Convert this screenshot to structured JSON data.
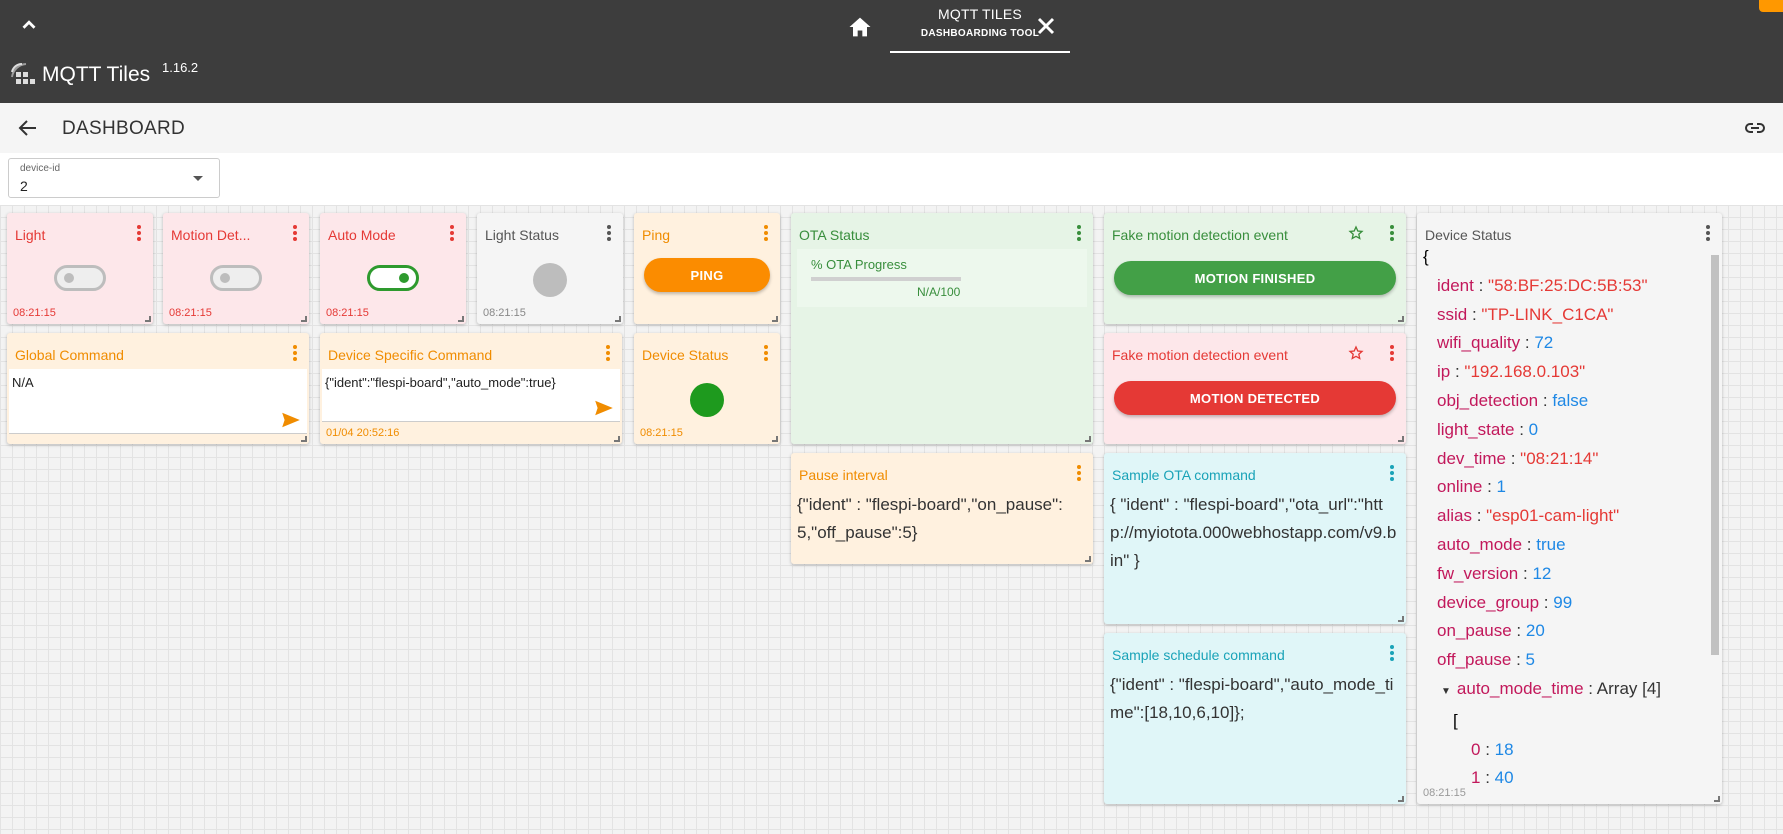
{
  "header": {
    "tab_title": "MQTT TILES",
    "tab_subtitle": "DASHBOARDING TOOL",
    "brand_name": "MQTT Tiles",
    "version": "1.16.2"
  },
  "toolbar": {
    "title": "DASHBOARD"
  },
  "selector": {
    "label": "device-id",
    "value": "2"
  },
  "tiles": {
    "light": {
      "title": "Light",
      "time": "08:21:15"
    },
    "motion": {
      "title": "Motion Det...",
      "time": "08:21:15"
    },
    "auto_mode": {
      "title": "Auto Mode",
      "time": "08:21:15"
    },
    "light_status": {
      "title": "Light Status",
      "time": "08:21:15"
    },
    "ping": {
      "title": "Ping",
      "button": "PING"
    },
    "ota_status": {
      "title": "OTA Status",
      "progress_label": "% OTA Progress",
      "progress_value": "N/A/100"
    },
    "motion_finished": {
      "title": "Fake motion detection event",
      "button": "MOTION FINISHED"
    },
    "motion_detected": {
      "title": "Fake motion detection event",
      "button": "MOTION DETECTED"
    },
    "global_cmd": {
      "title": "Global Command",
      "value": "N/A"
    },
    "device_cmd": {
      "title": "Device Specific Command",
      "value": "{\"ident\":\"flespi-board\",\"auto_mode\":true}",
      "time": "01/04 20:52:16"
    },
    "device_status_small": {
      "title": "Device Status",
      "time": "08:21:15"
    },
    "pause_interval": {
      "title": "Pause interval",
      "text": "{\"ident\" : \"flespi-board\",\"on_pause\": 5,\"off_pause\":5}"
    },
    "sample_ota": {
      "title": "Sample OTA command",
      "text": "{ \"ident\" : \"flespi-board\",\"ota_url\":\"http://myiotota.000webhostapp.com/v9.bin\" }"
    },
    "sample_schedule": {
      "title": "Sample schedule command",
      "text": "{\"ident\" : \"flespi-board\",\"auto_mode_time\":[18,10,6,10]};"
    },
    "device_status_json": {
      "title": "Device Status",
      "time": "08:21:15",
      "open_brace": "{",
      "open_bracket": "[",
      "rows": [
        {
          "key": "ident",
          "value": "\"58:BF:25:DC:5B:53\""
        },
        {
          "key": "ssid",
          "value": "\"TP-LINK_C1CA\""
        },
        {
          "key": "wifi_quality",
          "value": "72"
        },
        {
          "key": "ip",
          "value": "\"192.168.0.103\""
        },
        {
          "key": "obj_detection",
          "value": "false"
        },
        {
          "key": "light_state",
          "value": "0"
        },
        {
          "key": "dev_time",
          "value": "\"08:21:14\""
        },
        {
          "key": "online",
          "value": "1"
        },
        {
          "key": "alias",
          "value": "\"esp01-cam-light\""
        },
        {
          "key": "auto_mode",
          "value": "true"
        },
        {
          "key": "fw_version",
          "value": "12"
        },
        {
          "key": "device_group",
          "value": "99"
        },
        {
          "key": "on_pause",
          "value": "20"
        },
        {
          "key": "off_pause",
          "value": "5"
        }
      ],
      "array_key": "auto_mode_time",
      "array_label": "Array [4]",
      "array_items": [
        {
          "index": "0",
          "value": "18"
        },
        {
          "index": "1",
          "value": "40"
        }
      ]
    }
  },
  "colors": {
    "header_bg": "#3d3d3d",
    "red": "#e53935",
    "green": "#388e3c",
    "orange": "#f08c00",
    "cyan": "#1aa3b8"
  }
}
